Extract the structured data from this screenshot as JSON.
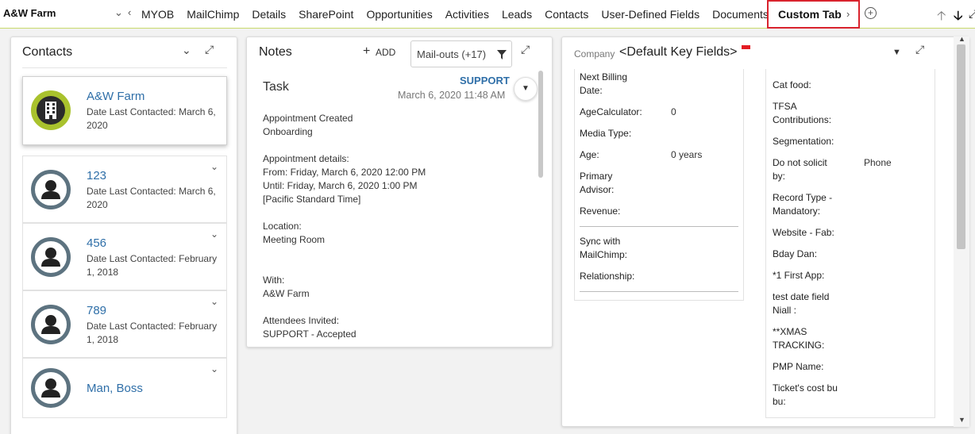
{
  "header": {
    "company": "A&W Farm",
    "tabs": [
      "MYOB",
      "MailChimp",
      "Details",
      "SharePoint",
      "Opportunities",
      "Activities",
      "Leads",
      "Contacts",
      "User-Defined Fields",
      "Documents"
    ],
    "active_tab": "Custom Tab"
  },
  "contacts": {
    "title": "Contacts",
    "items": [
      {
        "name": "A&W Farm",
        "date": "Date Last Contacted: March 6, 2020"
      },
      {
        "name": "123",
        "date": "Date Last Contacted: March 6, 2020"
      },
      {
        "name": "456",
        "date": "Date Last Contacted: February 1, 2018"
      },
      {
        "name": "789",
        "date": "Date Last Contacted: February 1, 2018"
      },
      {
        "name": "Man, Boss",
        "date": ""
      }
    ]
  },
  "notes": {
    "title": "Notes",
    "add_label": "ADD",
    "filter": "Mail-outs (+17)",
    "note": {
      "title": "Task",
      "user": "SUPPORT",
      "date": "March 6, 2020 11:48 AM",
      "body": "Appointment Created\nOnboarding\n\nAppointment details:\nFrom: Friday, March 6, 2020 12:00 PM\nUntil: Friday, March 6, 2020 1:00 PM\n[Pacific Standard Time]\n\nLocation:\nMeeting Room\n\n\nWith:\nA&W Farm\n\nAttendees Invited:\nSUPPORT - Accepted"
    }
  },
  "key_fields": {
    "company_label": "Company",
    "title": "<Default Key Fields>",
    "left": [
      {
        "label": "Next Billing Date:",
        "value": ""
      },
      {
        "label": "AgeCalculator:",
        "value": "0"
      },
      {
        "label": "Media Type:",
        "value": ""
      },
      {
        "label": "Age:",
        "value": "0 years"
      },
      {
        "label": "Primary Advisor:",
        "value": ""
      },
      {
        "label": "Revenue:",
        "value": ""
      },
      {
        "label": "Sync with MailChimp:",
        "value": ""
      },
      {
        "label": "Relationship:",
        "value": ""
      }
    ],
    "right": [
      {
        "label": "Cat food:",
        "value": ""
      },
      {
        "label": "TFSA Contributions:",
        "value": ""
      },
      {
        "label": "Segmentation:",
        "value": ""
      },
      {
        "label": "Do not solicit by:",
        "value": "Phone"
      },
      {
        "label": "Record Type - Mandatory:",
        "value": ""
      },
      {
        "label": "Website - Fab:",
        "value": ""
      },
      {
        "label": "Bday Dan:",
        "value": ""
      },
      {
        "label": "*1 First App:",
        "value": ""
      },
      {
        "label": "test date field Niall :",
        "value": ""
      },
      {
        "label": "**XMAS TRACKING:",
        "value": ""
      },
      {
        "label": "PMP Name:",
        "value": ""
      },
      {
        "label": "Ticket's cost bu bu:",
        "value": ""
      }
    ]
  }
}
